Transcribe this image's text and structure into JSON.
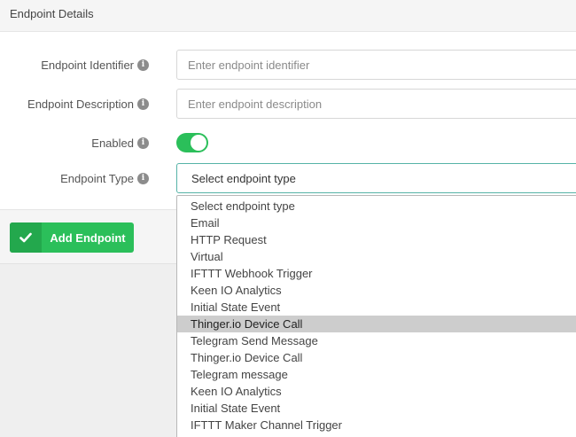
{
  "header": {
    "title": "Endpoint Details"
  },
  "form": {
    "identifier": {
      "label": "Endpoint Identifier",
      "placeholder": "Enter endpoint identifier",
      "value": ""
    },
    "description": {
      "label": "Endpoint Description",
      "placeholder": "Enter endpoint description",
      "value": ""
    },
    "enabled": {
      "label": "Enabled",
      "state": "on"
    },
    "type": {
      "label": "Endpoint Type",
      "selected": "Select endpoint type"
    },
    "info_icon_glyph": "i"
  },
  "footer": {
    "add_button_label": "Add Endpoint"
  },
  "dropdown": {
    "highlighted_index": 7,
    "options": [
      "Select endpoint type",
      "Email",
      "HTTP Request",
      "Virtual",
      "IFTTT Webhook Trigger",
      "Keen IO Analytics",
      "Initial State Event",
      "Thinger.io Device Call",
      "Telegram Send Message",
      "Thinger.io Device Call",
      "Telegram message",
      "Keen IO Analytics",
      "Initial State Event",
      "IFTTT Maker Channel Trigger"
    ]
  },
  "colors": {
    "accent_green": "#2bbf5a",
    "select_border": "#56b3a7",
    "highlight": "#cdcdcd"
  },
  "icons": {
    "info": "info-icon",
    "add": "check-icon"
  }
}
